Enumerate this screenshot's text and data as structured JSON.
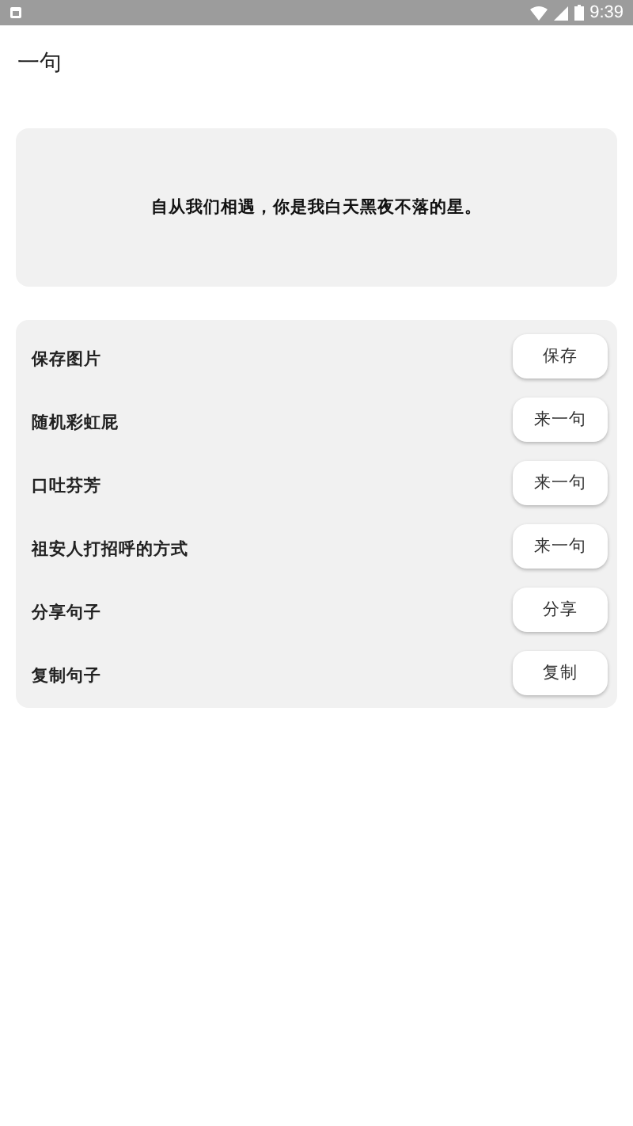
{
  "status_bar": {
    "time": "9:39"
  },
  "title": "一句",
  "quote": "自从我们相遇，你是我白天黑夜不落的星。",
  "actions": [
    {
      "label": "保存图片",
      "button": "保存"
    },
    {
      "label": "随机彩虹屁",
      "button": "来一句"
    },
    {
      "label": "口吐芬芳",
      "button": "来一句"
    },
    {
      "label": "祖安人打招呼的方式",
      "button": "来一句"
    },
    {
      "label": "分享句子",
      "button": "分享"
    },
    {
      "label": "复制句子",
      "button": "复制"
    }
  ]
}
